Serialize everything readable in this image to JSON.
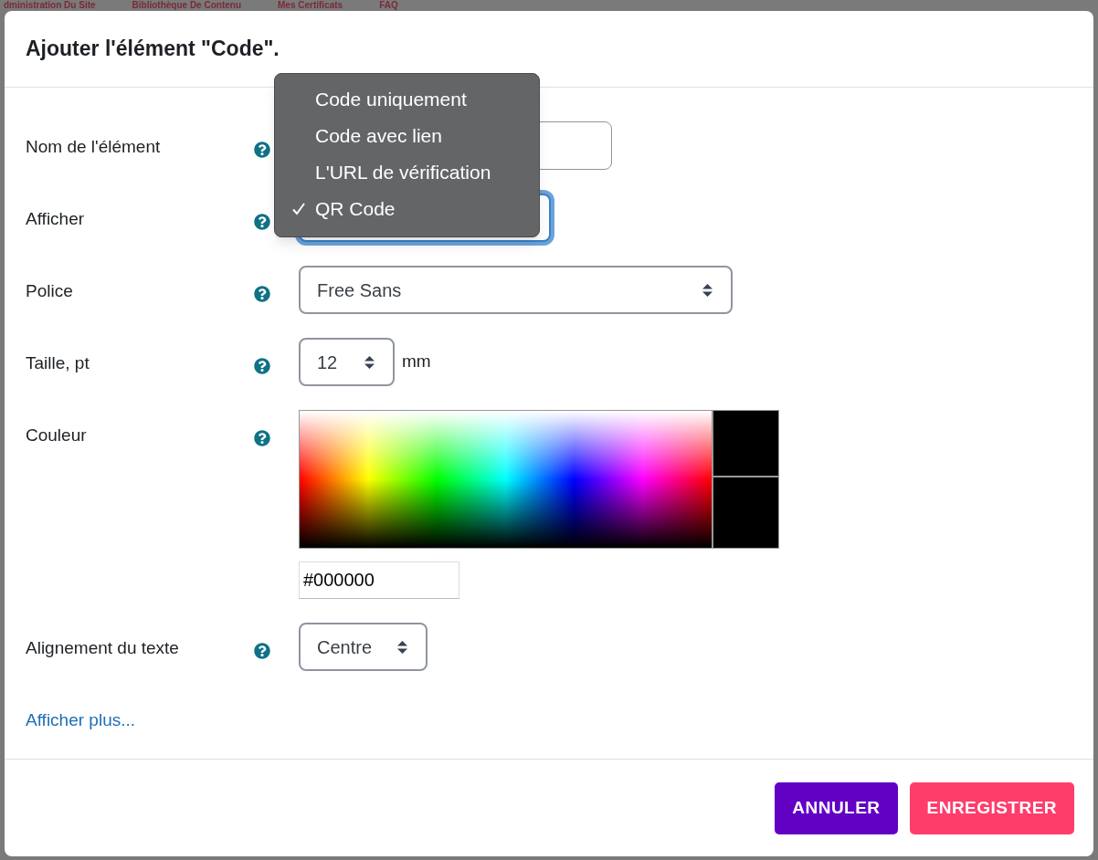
{
  "background_nav": [
    "dministration Du Site",
    "Bibliothèque De Contenu",
    "Mes Certificats",
    "FAQ"
  ],
  "dialog": {
    "title": "Ajouter l'élément \"Code\".",
    "fields": [
      {
        "kind": "text",
        "label": "Nom de l'élément"
      },
      {
        "kind": "select",
        "label": "Afficher",
        "focused": true
      },
      {
        "kind": "select",
        "label": "Police",
        "value": "Free Sans",
        "focused": false
      },
      {
        "kind": "select",
        "label": "Taille, pt",
        "value": "12",
        "unit": "mm",
        "focused": false
      },
      {
        "kind": "color",
        "label": "Couleur",
        "value": "#000000"
      },
      {
        "kind": "select",
        "label": "Alignement du texte",
        "value": "Centre",
        "focused": false
      }
    ],
    "more_link": "Afficher plus...",
    "buttons": [
      {
        "kind": "secondary",
        "label": "ANNULER"
      },
      {
        "kind": "primary",
        "label": "ENREGISTRER"
      }
    ]
  },
  "dropdown": {
    "options": [
      {
        "label": "Code uniquement",
        "selected": false
      },
      {
        "label": "Code avec lien",
        "selected": false
      },
      {
        "label": "L'URL de vérification",
        "selected": false
      },
      {
        "label": "QR Code",
        "selected": true
      }
    ]
  }
}
